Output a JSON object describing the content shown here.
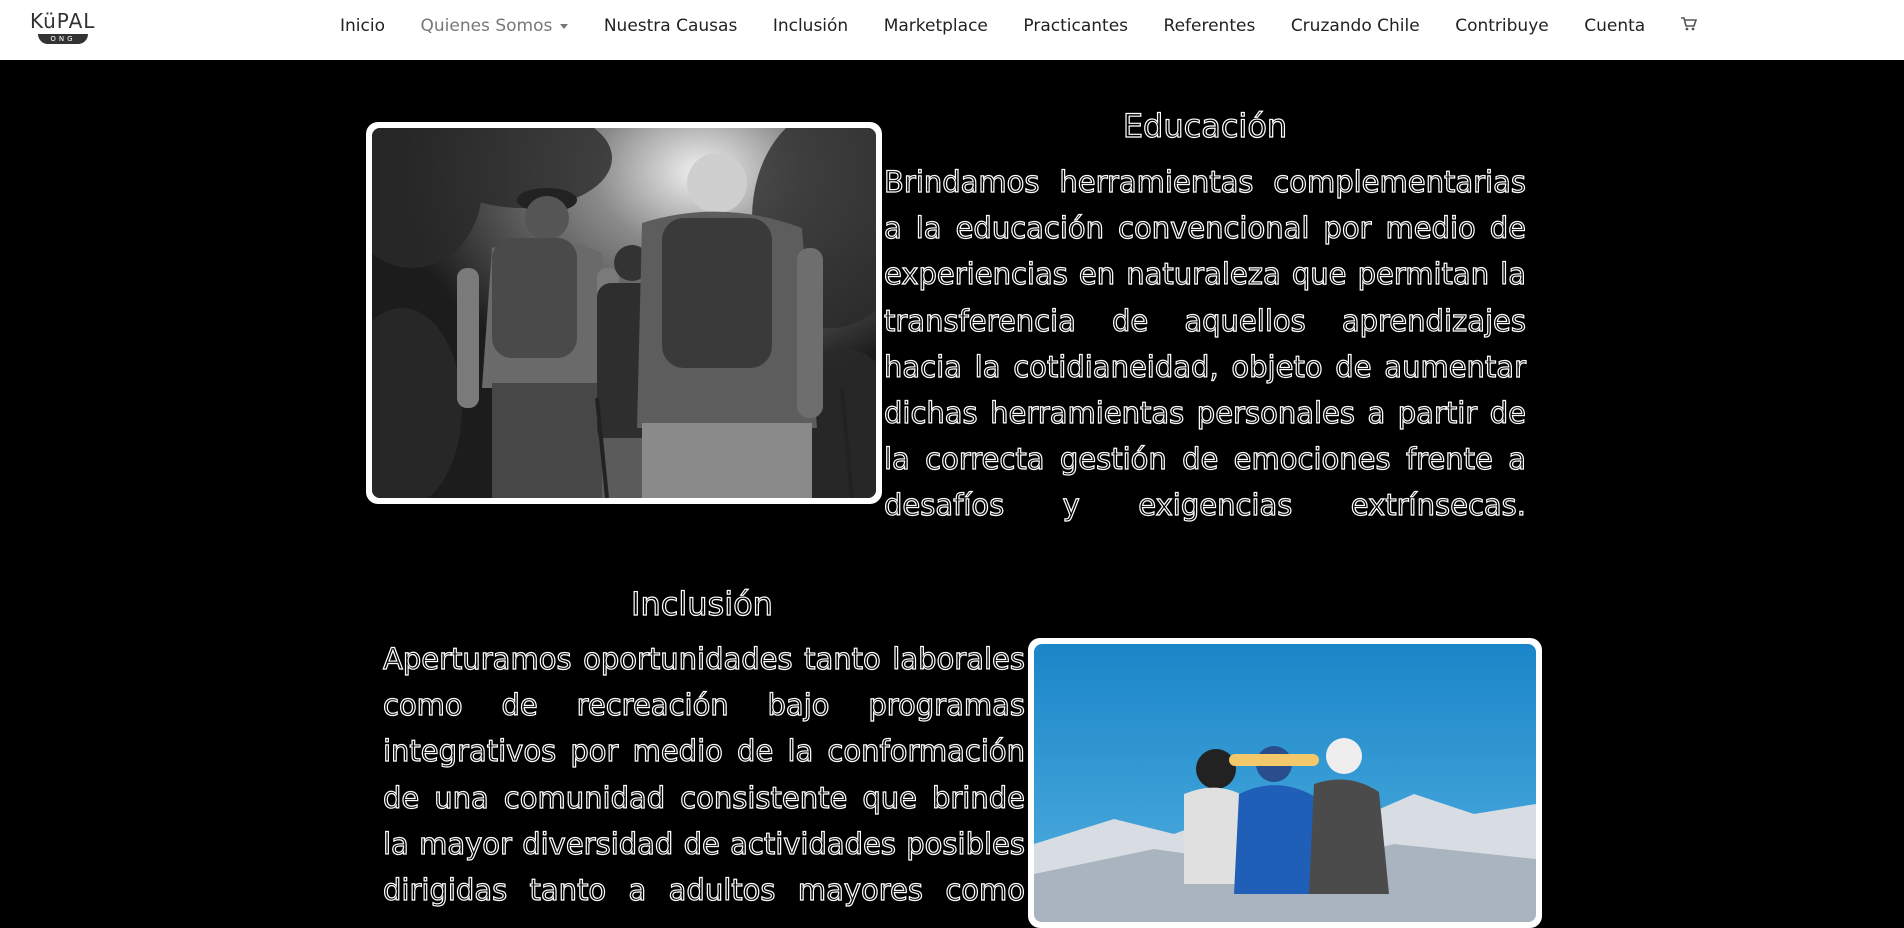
{
  "brand": {
    "name": "KüPAL",
    "sub": "ONG"
  },
  "nav": {
    "items": [
      {
        "label": "Inicio"
      },
      {
        "label": "Quienes Somos"
      },
      {
        "label": "Nuestra Causas"
      },
      {
        "label": "Inclusión"
      },
      {
        "label": "Marketplace"
      },
      {
        "label": "Practicantes"
      },
      {
        "label": "Referentes"
      },
      {
        "label": "Cruzando Chile"
      },
      {
        "label": "Contribuye"
      },
      {
        "label": "Cuenta"
      }
    ],
    "cart_icon": "cart-icon"
  },
  "sections": [
    {
      "title": "Educación",
      "body": "Brindamos herramientas complementarias a la educación convencional por medio de experiencias en naturaleza que permitan la transferencia de aquellos aprendizajes hacia la cotidianeidad, objeto de aumentar dichas herramientas personales a partir de la correcta gestión de emociones frente a desafíos y exigencias extrínsecas."
    },
    {
      "title": "Inclusión",
      "body": "Aperturamos oportunidades tanto laborales como de recreación bajo programas integrativos por medio de la conformación de una comunidad consistente que brinde la mayor diversidad de actividades posibles dirigidas tanto a adultos mayores como"
    }
  ],
  "colors": {
    "background": "#000000",
    "navbar": "#ffffff",
    "text_outline": "#ffffff",
    "sky": "#1d8fd0"
  }
}
